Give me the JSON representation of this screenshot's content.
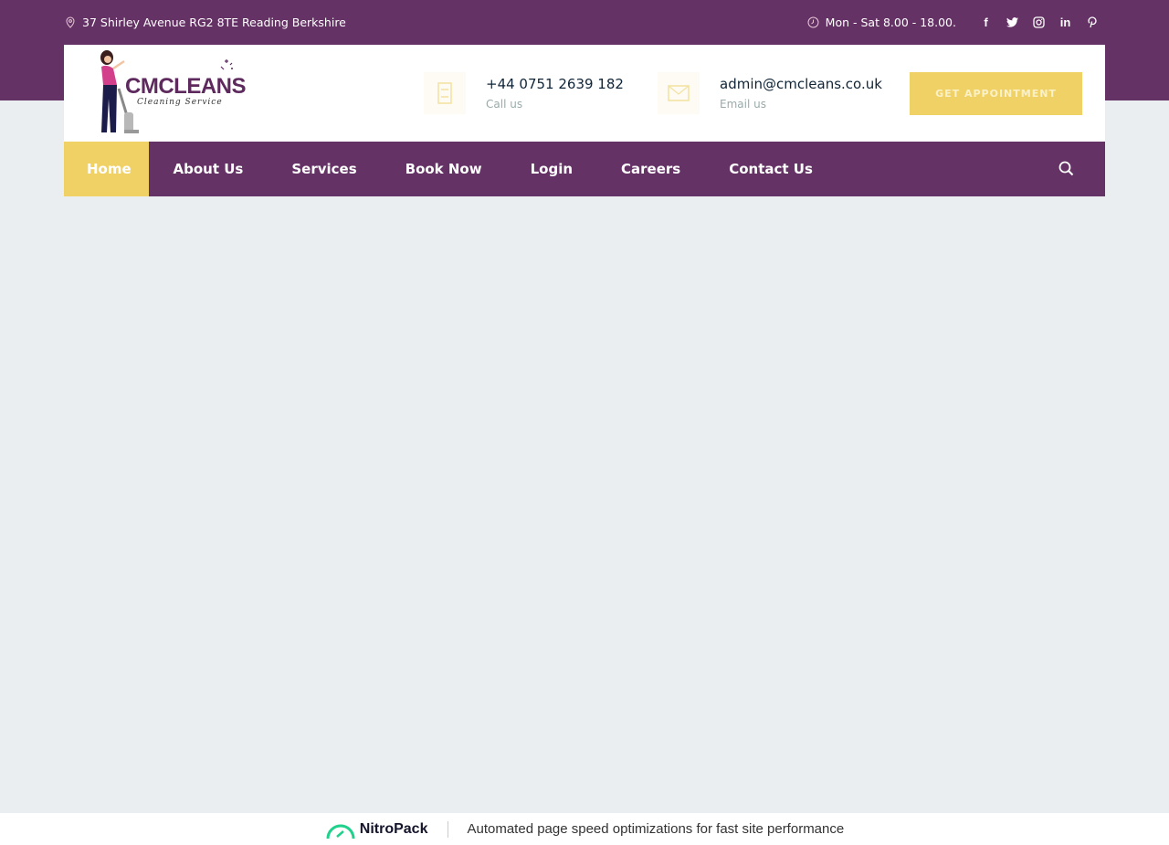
{
  "colors": {
    "brand_purple": "#653265",
    "accent_yellow": "#f0d166",
    "page_bg": "#ebeef0",
    "nitropack_green": "#1fd18b"
  },
  "topbar": {
    "address_icon": "map-pin-icon",
    "address": "37 Shirley Avenue RG2 8TE Reading Berkshire",
    "hours_icon": "clock-icon",
    "hours": "Mon - Sat 8.00 - 18.00.",
    "social": [
      {
        "name": "facebook",
        "glyph": "f"
      },
      {
        "name": "twitter",
        "glyph": "t"
      },
      {
        "name": "instagram",
        "glyph": "ig"
      },
      {
        "name": "linkedin",
        "glyph": "in"
      },
      {
        "name": "pinterest",
        "glyph": "p"
      }
    ]
  },
  "header": {
    "logo": {
      "title": "CMCLEANS",
      "subtitle": "Cleaning Service"
    },
    "phone": {
      "icon": "phone-icon",
      "value": "+44 0751 2639 182",
      "label": "Call us"
    },
    "email": {
      "icon": "envelope-icon",
      "value": "admin@cmcleans.co.uk",
      "label": "Email us"
    },
    "cta_label": "Get Appointment"
  },
  "nav": {
    "items": [
      {
        "label": "Home",
        "active": true
      },
      {
        "label": "About Us",
        "active": false
      },
      {
        "label": "Services",
        "active": false
      },
      {
        "label": "Book Now",
        "active": false
      },
      {
        "label": "Login",
        "active": false
      },
      {
        "label": "Careers",
        "active": false
      },
      {
        "label": "Contact Us",
        "active": false
      }
    ],
    "search_icon": "search-icon"
  },
  "footer": {
    "brand": "NitroPack",
    "tagline": "Automated page speed optimizations for fast site performance"
  }
}
